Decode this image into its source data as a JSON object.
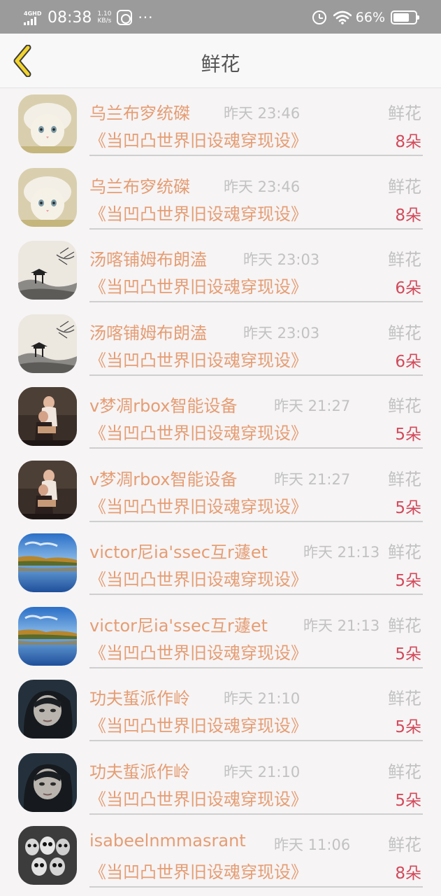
{
  "status_bar": {
    "network": "4GHD",
    "time": "08:38",
    "speed_value": "1.10",
    "speed_unit": "KB/s",
    "more": "···",
    "battery_percent": "66%",
    "battery_level": 0.66
  },
  "header": {
    "back_icon": "chevron-left-icon",
    "title": "鲜花"
  },
  "list": [
    {
      "name": "乌兰布穸统磔",
      "time": "昨天 23:46",
      "kind": "鲜花",
      "book": "《当凹凸世界旧设魂穿现设》",
      "count": "8朵",
      "avatar": "cat-avatar"
    },
    {
      "name": "乌兰布穸统磔",
      "time": "昨天 23:46",
      "kind": "鲜花",
      "book": "《当凹凸世界旧设魂穿现设》",
      "count": "8朵",
      "avatar": "cat-avatar"
    },
    {
      "name": "汤喀铺姆布朗溘",
      "time": "昨天 23:03",
      "kind": "鲜花",
      "book": "《当凹凸世界旧设魂穿现设》",
      "count": "6朵",
      "avatar": "ink-painting-avatar"
    },
    {
      "name": "汤喀铺姆布朗溘",
      "time": "昨天 23:03",
      "kind": "鲜花",
      "book": "《当凹凸世界旧设魂穿现设》",
      "count": "6朵",
      "avatar": "ink-painting-avatar"
    },
    {
      "name": "v梦凋rbox智能设备",
      "time": "昨天 21:27",
      "kind": "鲜花",
      "book": "《当凹凸世界旧设魂穿现设》",
      "count": "5朵",
      "avatar": "couple-photo-avatar"
    },
    {
      "name": "v梦凋rbox智能设备",
      "time": "昨天 21:27",
      "kind": "鲜花",
      "book": "《当凹凸世界旧设魂穿现设》",
      "count": "5朵",
      "avatar": "couple-photo-avatar"
    },
    {
      "name": "victor尼ia'ssec互r蘧et",
      "time": "昨天 21:13",
      "kind": "鲜花",
      "book": "《当凹凸世界旧设魂穿现设》",
      "count": "5朵",
      "avatar": "lake-landscape-avatar"
    },
    {
      "name": "victor尼ia'ssec互r蘧et",
      "time": "昨天 21:13",
      "kind": "鲜花",
      "book": "《当凹凸世界旧设魂穿现设》",
      "count": "5朵",
      "avatar": "lake-landscape-avatar"
    },
    {
      "name": "功夫蜇派作岭",
      "time": "昨天 21:10",
      "kind": "鲜花",
      "book": "《当凹凸世界旧设魂穿现设》",
      "count": "5朵",
      "avatar": "girl-portrait-avatar"
    },
    {
      "name": "功夫蜇派作岭",
      "time": "昨天 21:10",
      "kind": "鲜花",
      "book": "《当凹凸世界旧设魂穿现设》",
      "count": "5朵",
      "avatar": "girl-portrait-avatar"
    },
    {
      "name": "isabeelnmmasrant",
      "time": "昨天 11:06",
      "kind": "鲜花",
      "book": "《当凹凸世界旧设魂穿现设》",
      "count": "8朵",
      "avatar": "skulls-avatar"
    }
  ],
  "colors": {
    "name_text": "#e59d73",
    "count_text": "#d24a5a",
    "muted_text": "#c2c2c2",
    "back_icon_fill": "#f2d42e"
  }
}
